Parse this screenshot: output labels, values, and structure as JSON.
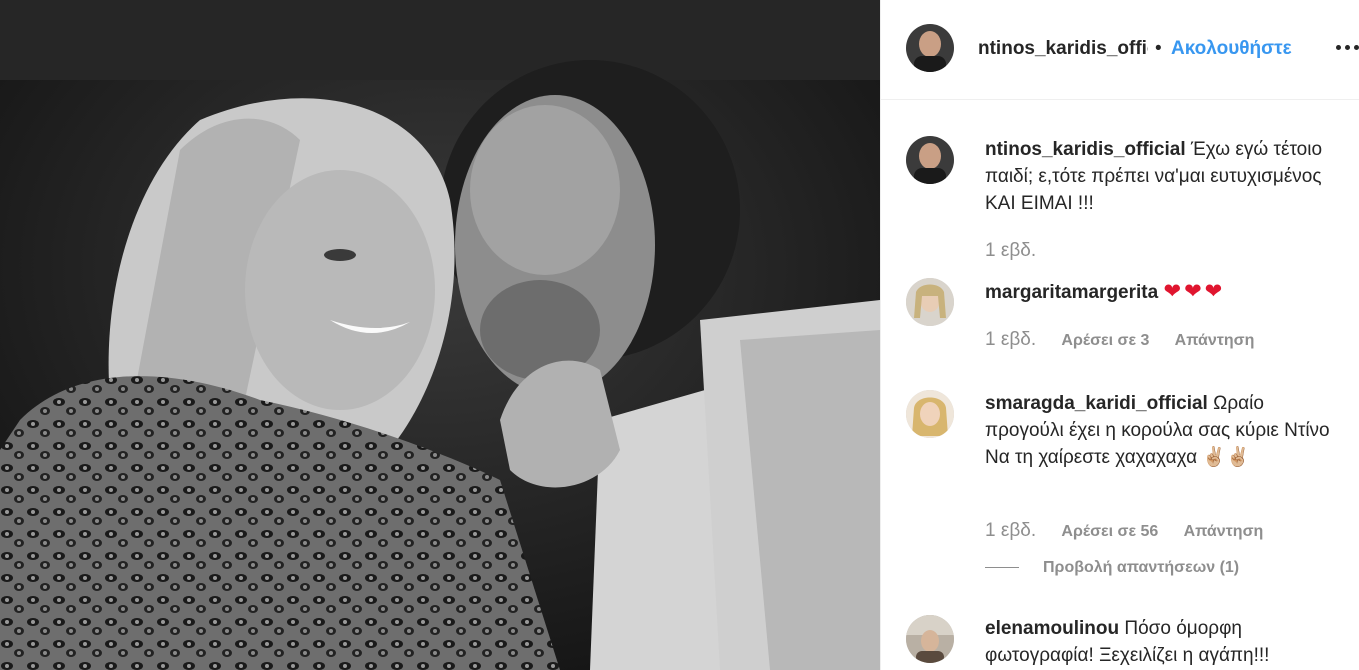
{
  "post": {
    "photo_alt": "black-and-white photo",
    "photo_icon": "photo"
  },
  "header": {
    "username": "ntinos_karidis_official",
    "separator": "•",
    "follow_label": "Ακολουθήστε",
    "more_icon": "more-horizontal-icon"
  },
  "caption": {
    "username": "ntinos_karidis_official",
    "text": "Έχω εγώ τέτοιο παιδί; ε,τότε πρέπει να'μαι ευτυχισμένος ΚΑΙ ΕΙΜΑΙ !!!",
    "time": "1 εβδ."
  },
  "comments": [
    {
      "username": "margaritamargerita",
      "text": "❤❤❤",
      "time": "1 εβδ.",
      "likes": "Αρέσει σε 3",
      "reply": "Απάντηση"
    },
    {
      "username": "smaragda_karidi_official",
      "text_line1": "Ωραίο προγούλι έχει η κορούλα σας κύριε Ντίνο",
      "text_line2": "Να τη χαίρεστε χαχαχαχα ✌🏼✌🏼",
      "time": "1 εβδ.",
      "likes": "Αρέσει σε 56",
      "reply": "Απάντηση",
      "view_replies": "Προβολή απαντήσεων (1)"
    },
    {
      "username": "elenamoulinou",
      "text": "Πόσο όμορφη φωτογραφία! Ξεχειλίζει η αγάπη!!!"
    }
  ],
  "colors": {
    "link_blue": "#3897f0",
    "text": "#262626",
    "muted": "#8e8e8e",
    "heart": "#e0152f"
  }
}
